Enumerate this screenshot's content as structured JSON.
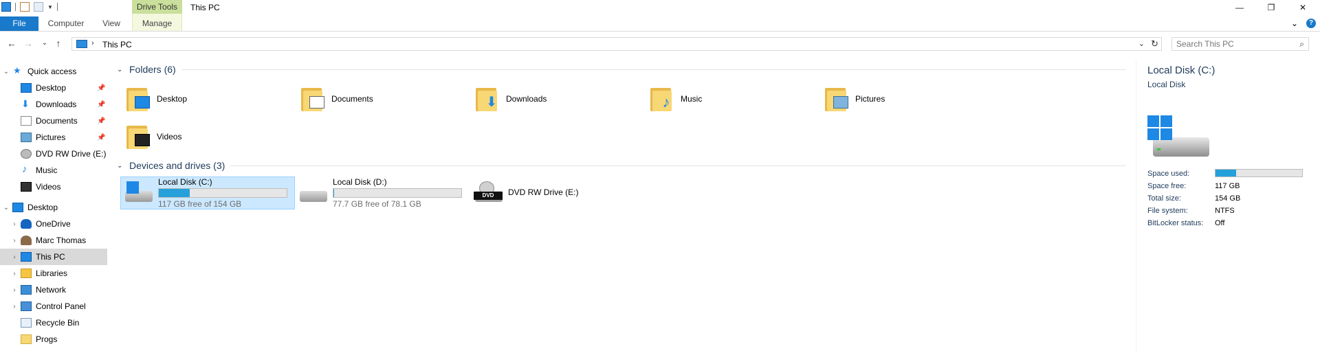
{
  "window": {
    "title": "This PC",
    "context_tab_group": "Drive Tools",
    "controls": {
      "minimize": "—",
      "maximize": "❐",
      "close": "✕"
    }
  },
  "ribbon": {
    "tabs": {
      "file": "File",
      "computer": "Computer",
      "view": "View",
      "manage": "Manage"
    },
    "collapse": "⌄",
    "help": "?"
  },
  "address": {
    "back": "←",
    "forward": "→",
    "recent": "⌄",
    "up": "↑",
    "separator": "›",
    "crumb": "This PC",
    "dropdown": "⌄",
    "refresh": "↻"
  },
  "search": {
    "placeholder": "Search This PC",
    "icon": "⌕"
  },
  "nav_pane": {
    "quick_access": "Quick access",
    "quick_items": [
      {
        "label": "Desktop",
        "icon": "desktop-icon",
        "pinned": true
      },
      {
        "label": "Downloads",
        "icon": "downloads-icon",
        "pinned": true
      },
      {
        "label": "Documents",
        "icon": "documents-icon",
        "pinned": true
      },
      {
        "label": "Pictures",
        "icon": "pictures-icon",
        "pinned": true
      },
      {
        "label": "DVD RW Drive (E:)",
        "icon": "dvd-drive-icon",
        "pinned": false
      },
      {
        "label": "Music",
        "icon": "music-icon",
        "pinned": false
      },
      {
        "label": "Videos",
        "icon": "videos-icon",
        "pinned": false
      }
    ],
    "desktop": "Desktop",
    "tree_items": [
      {
        "label": "OneDrive",
        "icon": "onedrive-icon"
      },
      {
        "label": "Marc Thomas",
        "icon": "user-icon"
      },
      {
        "label": "This PC",
        "icon": "this-pc-icon",
        "selected": true
      },
      {
        "label": "Libraries",
        "icon": "libraries-icon"
      },
      {
        "label": "Network",
        "icon": "network-icon"
      },
      {
        "label": "Control Panel",
        "icon": "control-panel-icon"
      },
      {
        "label": "Recycle Bin",
        "icon": "recycle-bin-icon"
      },
      {
        "label": "Progs",
        "icon": "folder-icon"
      }
    ],
    "pin_glyph": "📌",
    "expanded": "⌄",
    "collapsed": "›"
  },
  "main": {
    "folders_header": "Folders (6)",
    "folders": [
      {
        "label": "Desktop",
        "icon": "desktop-folder-icon"
      },
      {
        "label": "Documents",
        "icon": "documents-folder-icon"
      },
      {
        "label": "Downloads",
        "icon": "downloads-folder-icon"
      },
      {
        "label": "Music",
        "icon": "music-folder-icon"
      },
      {
        "label": "Pictures",
        "icon": "pictures-folder-icon"
      },
      {
        "label": "Videos",
        "icon": "videos-folder-icon"
      }
    ],
    "devices_header": "Devices and drives (3)",
    "drives": [
      {
        "name": "Local Disk (C:)",
        "free": "117 GB free of 154 GB",
        "used_fraction": 0.24,
        "selected": true
      },
      {
        "name": "Local Disk (D:)",
        "free": "77.7 GB free of 78.1 GB",
        "used_fraction": 0.005,
        "selected": false
      },
      {
        "name": "DVD RW Drive (E:)",
        "dvd_label": "DVD"
      }
    ]
  },
  "details": {
    "title": "Local Disk (C:)",
    "subtitle": "Local Disk",
    "props": [
      {
        "key": "Space used:",
        "value": ""
      },
      {
        "key": "Space free:",
        "value": "117 GB"
      },
      {
        "key": "Total size:",
        "value": "154 GB"
      },
      {
        "key": "File system:",
        "value": "NTFS"
      },
      {
        "key": "BitLocker status:",
        "value": "Off"
      }
    ],
    "used_fraction": 0.24
  },
  "colors": {
    "accent": "#1979ca",
    "selection": "#cce8ff",
    "context_tab": "#c9df9b",
    "progress": "#26a0da"
  }
}
